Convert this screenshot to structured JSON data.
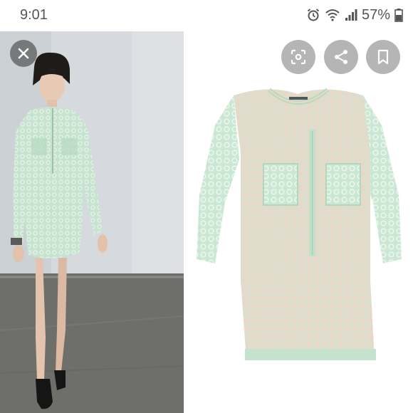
{
  "status_bar": {
    "time": "9:01",
    "battery": "57%",
    "icons": [
      "alarm-icon",
      "wifi-icon",
      "signal-icon",
      "battery-icon"
    ]
  },
  "overlay_buttons": {
    "close": "close-icon",
    "lens": "lens-icon",
    "share": "share-icon",
    "bookmark": "bookmark-icon"
  },
  "colors": {
    "dress_mint": "#c9e6d2",
    "dress_mint_dark": "#a9d0b8",
    "lining_peach": "#ead6c6",
    "backdrop": "#d9dde0",
    "floor": "#6f6f6c"
  }
}
